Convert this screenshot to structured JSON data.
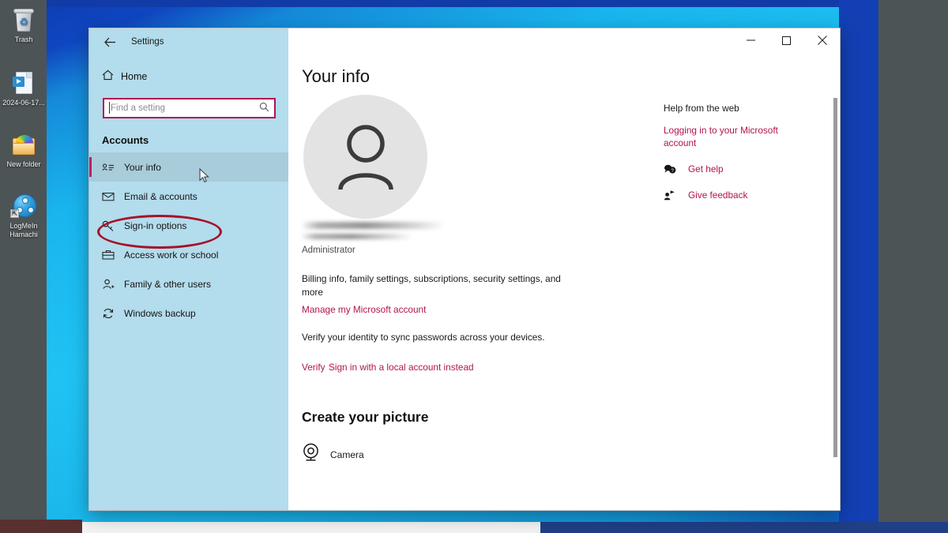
{
  "desktop": {
    "icons": [
      {
        "name": "trash",
        "label": "Trash"
      },
      {
        "name": "video-file",
        "label": "2024-06-17..."
      },
      {
        "name": "new-folder",
        "label": "New folder"
      },
      {
        "name": "logmein-hamachi",
        "label": "LogMeIn\nHamachi"
      }
    ]
  },
  "window": {
    "title": "Settings",
    "back_icon": "back-arrow-icon",
    "controls": {
      "minimize": "–",
      "maximize": "☐",
      "close": "✕"
    }
  },
  "sidebar": {
    "home": {
      "label": "Home",
      "icon": "home-icon"
    },
    "search": {
      "placeholder": "Find a setting",
      "value": "",
      "icon": "search-icon"
    },
    "section_title": "Accounts",
    "items": [
      {
        "label": "Your info",
        "icon": "id-card-icon",
        "selected": true
      },
      {
        "label": "Email & accounts",
        "icon": "envelope-icon",
        "selected": false
      },
      {
        "label": "Sign-in options",
        "icon": "key-icon",
        "selected": false,
        "annotated": true
      },
      {
        "label": "Access work or school",
        "icon": "briefcase-icon",
        "selected": false
      },
      {
        "label": "Family & other users",
        "icon": "person-add-icon",
        "selected": false
      },
      {
        "label": "Windows backup",
        "icon": "sync-icon",
        "selected": false
      }
    ],
    "annotation_color": "#a3132a",
    "accent_color": "#c01d5b"
  },
  "main": {
    "page_title": "Your info",
    "avatar_icon": "person-avatar-icon",
    "account_name_redacted": true,
    "account_role": "Administrator",
    "billing_text": "Billing info, family settings, subscriptions, security settings, and more",
    "manage_link": "Manage my Microsoft account",
    "verify_text": "Verify your identity to sync passwords across your devices.",
    "verify_link": "Verify",
    "local_account_link": "Sign in with a local account instead",
    "create_picture_heading": "Create your picture",
    "camera": {
      "label": "Camera",
      "icon": "camera-icon"
    },
    "link_color": "#b4134f"
  },
  "aside": {
    "title": "Help from the web",
    "web_link": "Logging in to your Microsoft account",
    "actions": [
      {
        "label": "Get help",
        "icon": "question-bubble-icon"
      },
      {
        "label": "Give feedback",
        "icon": "feedback-person-icon"
      }
    ]
  }
}
